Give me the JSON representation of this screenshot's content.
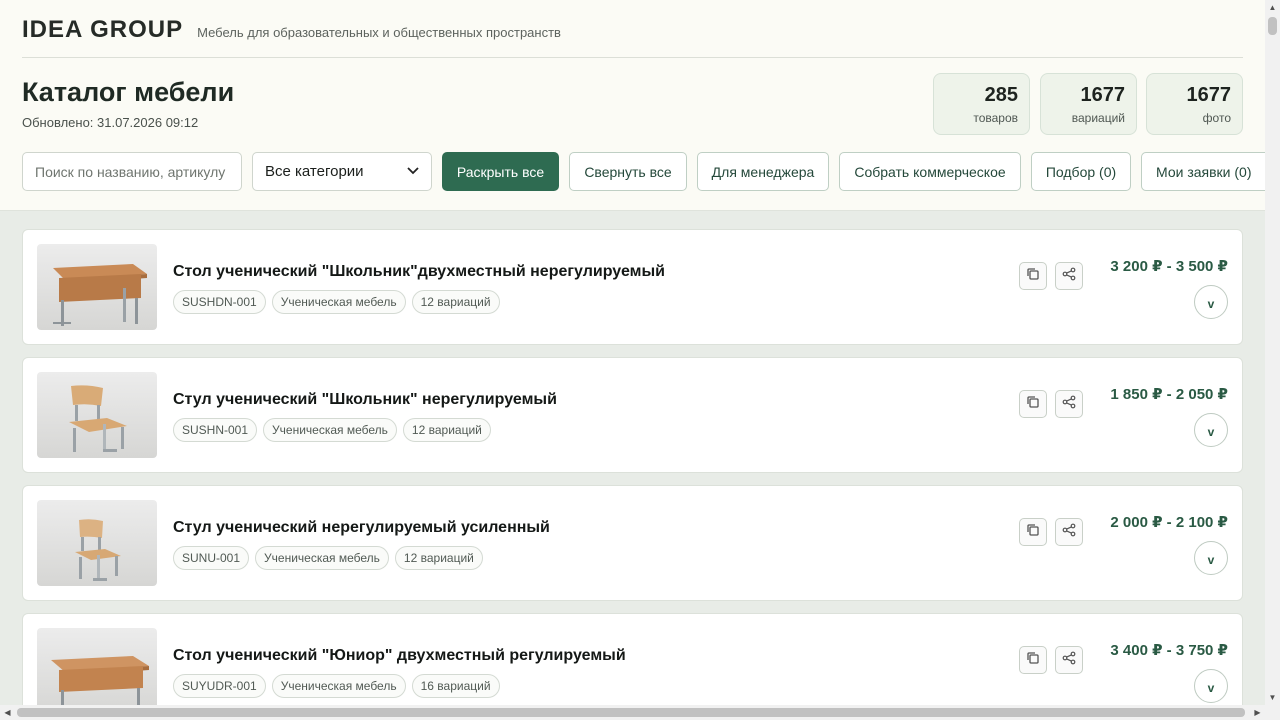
{
  "header": {
    "brand": "IDEA GROUP",
    "tagline": "Мебель для образовательных и общественных пространств",
    "title": "Каталог мебели",
    "updated": "Обновлено: 31.07.2026 09:12"
  },
  "stats": [
    {
      "value": "285",
      "label": "товаров"
    },
    {
      "value": "1677",
      "label": "вариаций"
    },
    {
      "value": "1677",
      "label": "фото"
    }
  ],
  "toolbar": {
    "search_placeholder": "Поиск по названию, артикулу",
    "category_selected": "Все категории",
    "expand_all": "Раскрыть все",
    "collapse_all": "Свернуть все",
    "for_manager": "Для менеджера",
    "build_offer": "Собрать коммерческое",
    "selection": "Подбор (0)",
    "my_requests": "Мои заявки (0)"
  },
  "products": [
    {
      "name": "Стол ученический \"Школьник\"двухместный нерегулируемый",
      "sku": "SUSHDN-001",
      "category": "Ученическая мебель",
      "variations": "12 вариаций",
      "price": "3 200 ₽ - 3 500 ₽",
      "image": "desk"
    },
    {
      "name": "Стул ученический \"Школьник\" нерегулируемый",
      "sku": "SUSHN-001",
      "category": "Ученическая мебель",
      "variations": "12 вариаций",
      "price": "1 850 ₽ - 2 050 ₽",
      "image": "chair"
    },
    {
      "name": "Стул ученический нерегулируемый усиленный",
      "sku": "SUNU-001",
      "category": "Ученическая мебель",
      "variations": "12 вариаций",
      "price": "2 000 ₽ - 2 100 ₽",
      "image": "chair"
    },
    {
      "name": "Стол ученический \"Юниор\" двухместный регулируемый",
      "sku": "SUYUDR-001",
      "category": "Ученическая мебель",
      "variations": "16 вариаций",
      "price": "3 400 ₽ - 3 750 ₽",
      "image": "desk"
    }
  ],
  "expand_glyph": "v",
  "icons": {
    "copy": "copy-icon",
    "share": "share-icon"
  },
  "colors": {
    "accent": "#2e6b51",
    "price": "#2a5a44",
    "header_bg": "#fbfbf5",
    "page_bg": "#e8ece7"
  }
}
